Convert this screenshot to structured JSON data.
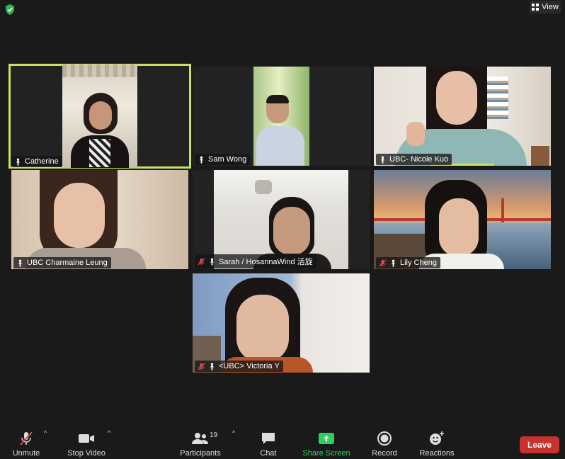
{
  "topbar": {
    "view_label": "View"
  },
  "participants": [
    {
      "name": "Catherine",
      "muted": false,
      "active_speaker": true
    },
    {
      "name": "Sam Wong",
      "muted": false,
      "active_speaker": false
    },
    {
      "name": "UBC- Nicole Kuo",
      "muted": false,
      "active_speaker": false
    },
    {
      "name": "UBC Charmaine Leung",
      "muted": false,
      "active_speaker": false
    },
    {
      "name": "Sarah / HosannaWind 活旋",
      "muted": true,
      "active_speaker": false
    },
    {
      "name": "Lily Cheng",
      "muted": true,
      "active_speaker": false
    },
    {
      "name": "<UBC> Victoria Y",
      "muted": true,
      "active_speaker": false
    }
  ],
  "toolbar": {
    "unmute_label": "Unmute",
    "stop_video_label": "Stop Video",
    "participants_label": "Participants",
    "participants_count": "19",
    "chat_label": "Chat",
    "share_screen_label": "Share Screen",
    "record_label": "Record",
    "reactions_label": "Reactions",
    "leave_label": "Leave"
  },
  "colors": {
    "active_outline": "#c9e35e",
    "share_green": "#2fd15c",
    "leave_red": "#c8312d",
    "shield_green": "#2db84c"
  }
}
